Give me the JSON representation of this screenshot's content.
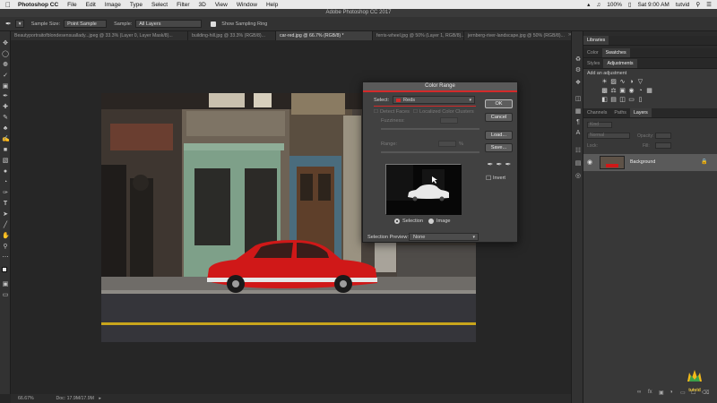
{
  "menubar": {
    "app_name": "Photoshop CC",
    "items": [
      "File",
      "Edit",
      "Image",
      "Type",
      "Select",
      "Filter",
      "3D",
      "View",
      "Window",
      "Help"
    ],
    "battery": "100%",
    "day_time": "Sat 9:00 AM",
    "user": "tutvid"
  },
  "window": {
    "title": "Adobe Photoshop CC 2017"
  },
  "options": {
    "sample_size_label": "Sample Size:",
    "sample_size_value": "Point Sample",
    "sample_label": "Sample:",
    "sample_value": "All Layers",
    "show_ring_label": "Show Sampling Ring"
  },
  "tabs": [
    {
      "label": "Beautyportraitofblondesensuallady...jpeg @ 33.3% (Layer 0, Layer Mask/8)..."
    },
    {
      "label": "building-hill.jpg @ 33.3% (RGB/8)..."
    },
    {
      "label": "car-red.jpg @ 66.7% (RGB/8) *"
    },
    {
      "label": "ferris-wheel.jpg @ 50% (Layer 1, RGB/8)..."
    },
    {
      "label": "jernberg-river-landscape.jpg @ 50% (RGB/8)..."
    }
  ],
  "status": {
    "zoom": "66.67%",
    "doc": "Doc: 17.9M/17.9M"
  },
  "panels": {
    "top_tabs": [
      "Libraries"
    ],
    "color_tabs": [
      "Color",
      "Swatches"
    ],
    "adj_tabs": [
      "Styles",
      "Adjustments"
    ],
    "add_adjustment": "Add an adjustment",
    "layer_tabs": [
      "Channels",
      "Paths",
      "Layers"
    ],
    "kind_label": "Kind",
    "blend_mode": "Normal",
    "opacity_label": "Opacity:",
    "lock_label": "Lock:",
    "fill_label": "Fill:",
    "layer_name": "Background"
  },
  "dialog": {
    "title": "Color Range",
    "select_label": "Select:",
    "select_value": "Reds",
    "detect_faces": "Detect Faces",
    "localized": "Localized Color Clusters",
    "fuzziness": "Fuzziness:",
    "range": "Range:",
    "range_unit": "%",
    "ok": "OK",
    "cancel": "Cancel",
    "load": "Load...",
    "save": "Save...",
    "invert": "Invert",
    "selection_radio": "Selection",
    "image_radio": "Image",
    "preview_label": "Selection Preview:",
    "preview_value": "None"
  },
  "watermark": {
    "text": "tutvid"
  },
  "colors": {
    "accent_red": "#d42a2a",
    "car_red": "#d01818"
  }
}
